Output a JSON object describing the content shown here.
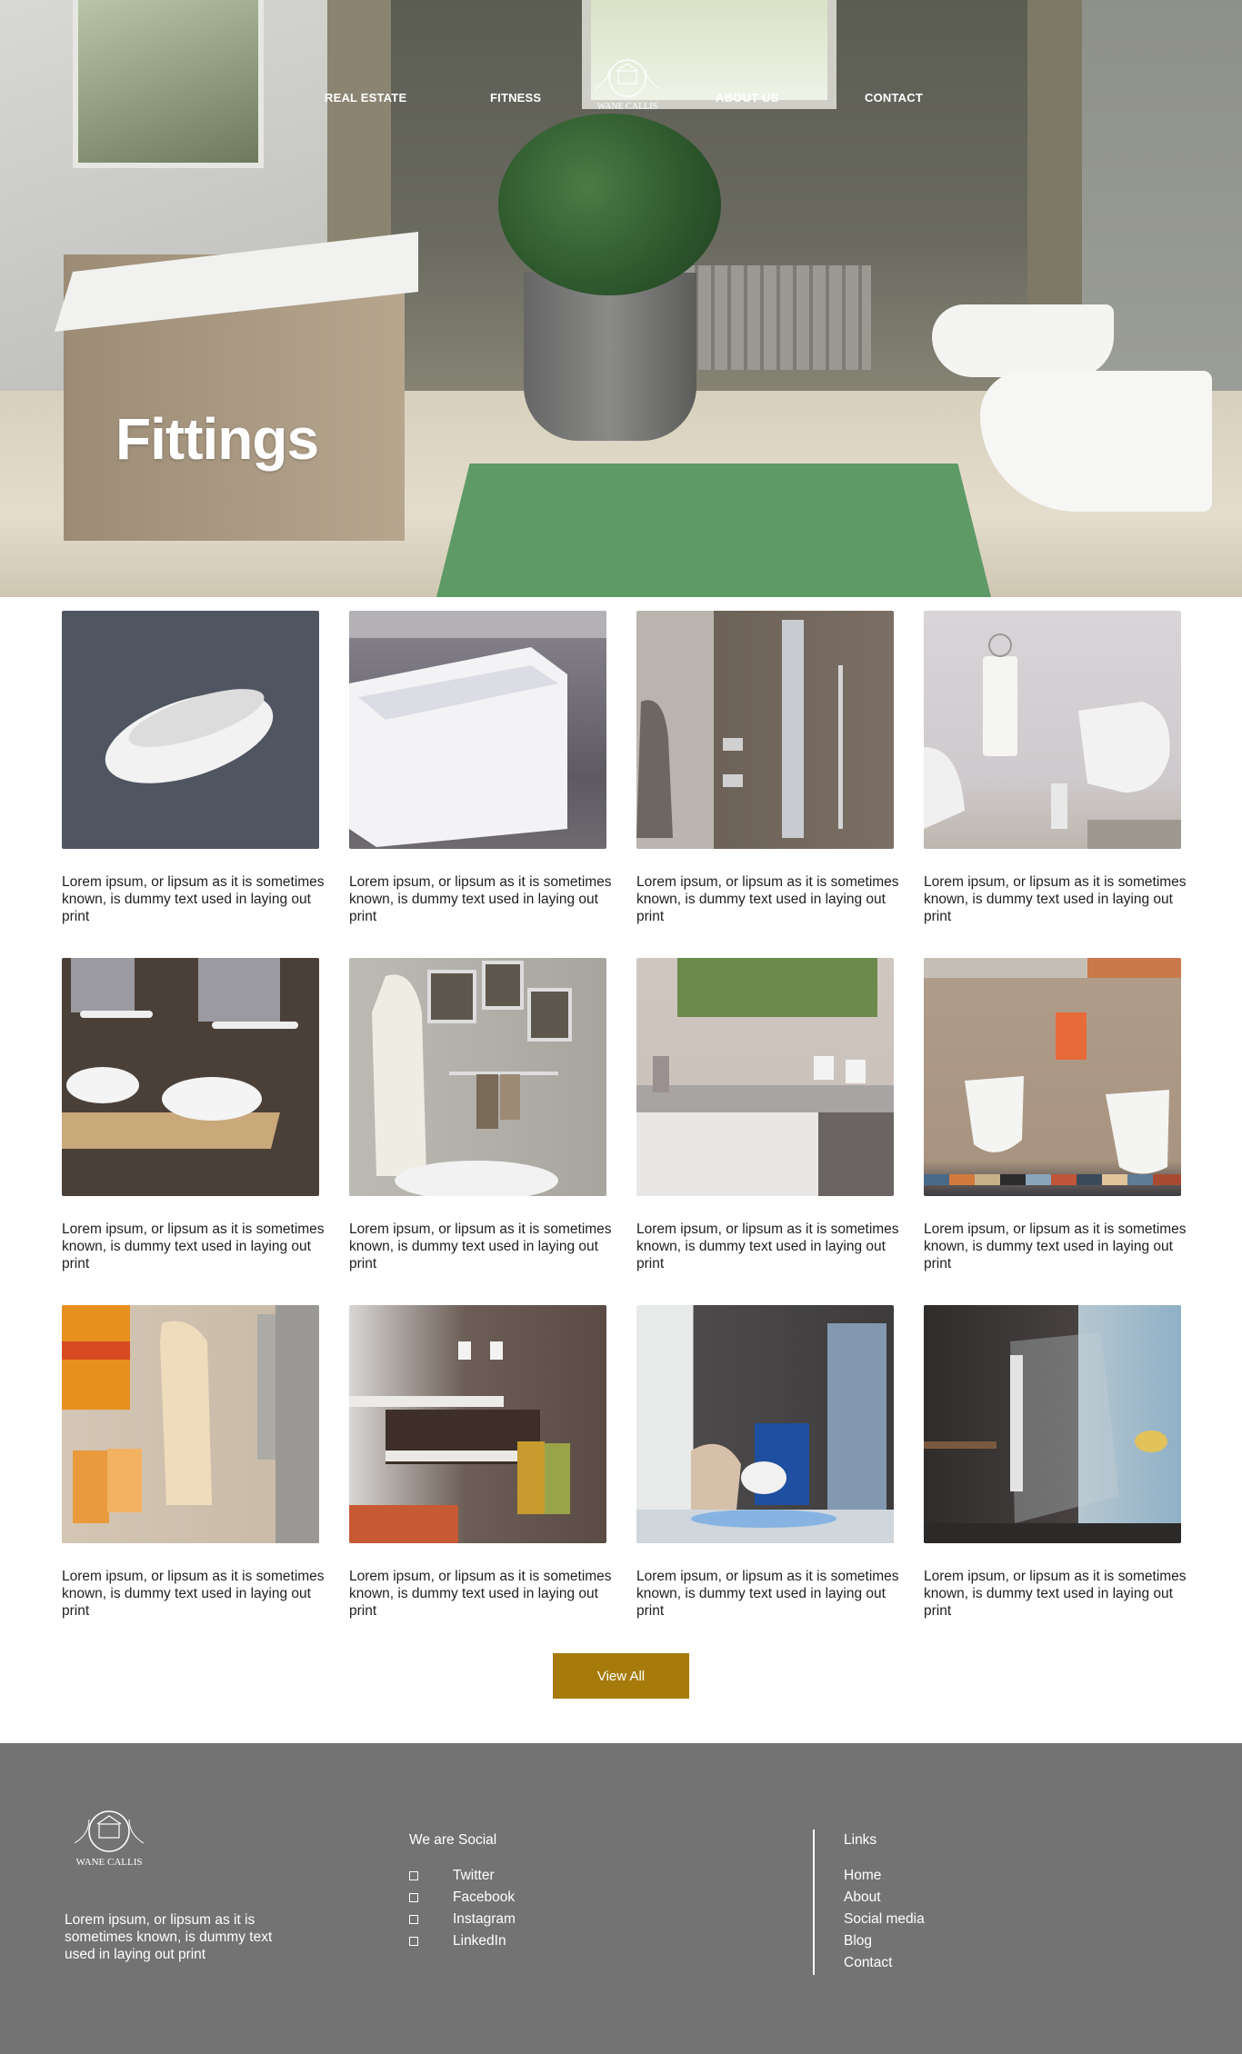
{
  "nav": {
    "items": [
      "REAL ESTATE",
      "FITNESS",
      "ABOUT US",
      "CONTACT"
    ],
    "logo_text": "WANE CALLIS"
  },
  "hero": {
    "title": "Fittings"
  },
  "products": [
    {
      "text": "Lorem ipsum, or lipsum as it is sometimes known, is dummy text used in laying out print",
      "image": "freestanding-bathtub"
    },
    {
      "text": "Lorem ipsum, or lipsum as it is sometimes known, is dummy text used in laying out print",
      "image": "built-in-bathtub"
    },
    {
      "text": "Lorem ipsum, or lipsum as it is sometimes known, is dummy text used in laying out print",
      "image": "shower-panel"
    },
    {
      "text": "Lorem ipsum, or lipsum as it is sometimes known, is dummy text used in laying out print",
      "image": "toilet-accessories"
    },
    {
      "text": "Lorem ipsum, or lipsum as it is sometimes known, is dummy text used in laying out print",
      "image": "double-vanity"
    },
    {
      "text": "Lorem ipsum, or lipsum as it is sometimes known, is dummy text used in laying out print",
      "image": "bathrobe-hooks"
    },
    {
      "text": "Lorem ipsum, or lipsum as it is sometimes known, is dummy text used in laying out print",
      "image": "washbasin-vanity"
    },
    {
      "text": "Lorem ipsum, or lipsum as it is sometimes known, is dummy text used in laying out print",
      "image": "toilet-bidet"
    },
    {
      "text": "Lorem ipsum, or lipsum as it is sometimes known, is dummy text used in laying out print",
      "image": "towels-shower"
    },
    {
      "text": "Lorem ipsum, or lipsum as it is sometimes known, is dummy text used in laying out print",
      "image": "vanity-towel-rail"
    },
    {
      "text": "Lorem ipsum, or lipsum as it is sometimes known, is dummy text used in laying out print",
      "image": "shower-cabin-blue"
    },
    {
      "text": "Lorem ipsum, or lipsum as it is sometimes known, is dummy text used in laying out print",
      "image": "glass-shower-enclosure"
    }
  ],
  "view_all": {
    "label": "View All",
    "color": "#a67b0c"
  },
  "footer": {
    "logo_text": "WANE CALLIS",
    "about": "Lorem ipsum, or lipsum as it is sometimes known, is dummy text used in laying out print",
    "social_title": "We are Social",
    "social": [
      "Twitter",
      "Facebook",
      "Instagram",
      "LinkedIn"
    ],
    "links_title": "Links",
    "links": [
      "Home",
      "About",
      "Social media",
      "Blog",
      "Contact"
    ],
    "background": "#737373"
  }
}
